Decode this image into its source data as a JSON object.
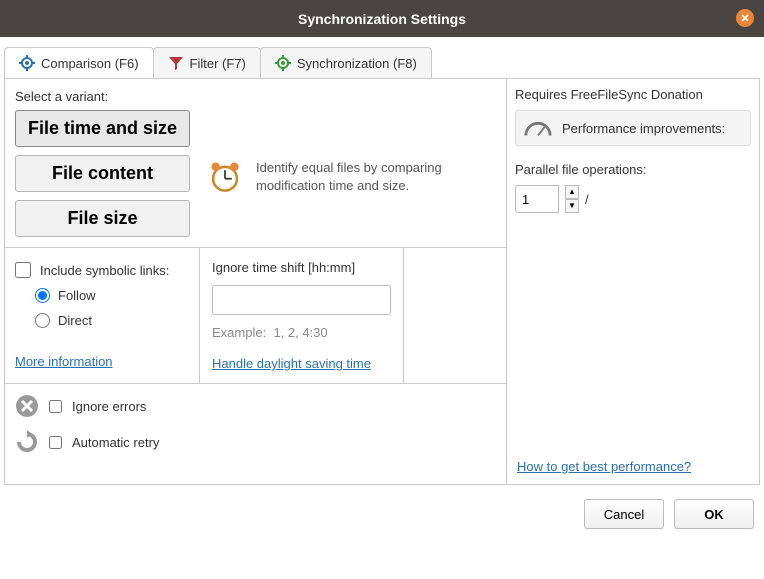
{
  "window": {
    "title": "Synchronization Settings"
  },
  "tabs": {
    "comparison": "Comparison (F6)",
    "filter": "Filter (F7)",
    "synchronization": "Synchronization (F8)"
  },
  "variant": {
    "label": "Select a variant:",
    "btn_time_size": "File time and size",
    "btn_content": "File content",
    "btn_size": "File size",
    "description": "Identify equal files by comparing modification time and size."
  },
  "symbolic": {
    "include": "Include symbolic links:",
    "follow": "Follow",
    "direct": "Direct",
    "more_info": "More information"
  },
  "timeshift": {
    "label": "Ignore time shift [hh:mm]",
    "example_label": "Example:",
    "example_value": "1, 2, 4:30",
    "dst_link": "Handle daylight saving time"
  },
  "errors": {
    "ignore": "Ignore errors",
    "retry": "Automatic retry"
  },
  "right": {
    "requires": "Requires FreeFileSync Donation",
    "perf": "Performance improvements:",
    "parallel_label": "Parallel file operations:",
    "parallel_value": "1",
    "slash": "/",
    "how_link": "How to get best performance?"
  },
  "footer": {
    "cancel": "Cancel",
    "ok": "OK"
  }
}
